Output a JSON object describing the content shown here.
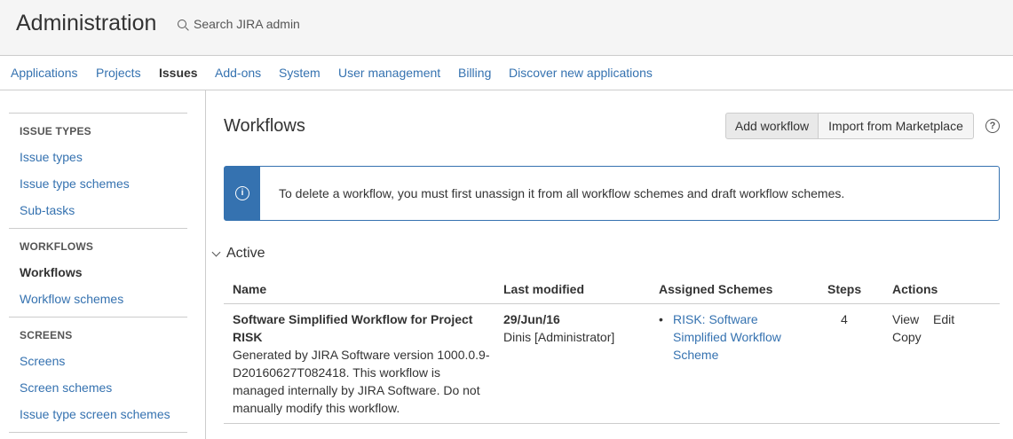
{
  "header": {
    "title": "Administration",
    "search_placeholder": "Search JIRA admin"
  },
  "nav": {
    "tabs": [
      {
        "label": "Applications"
      },
      {
        "label": "Projects"
      },
      {
        "label": "Issues",
        "active": true
      },
      {
        "label": "Add-ons"
      },
      {
        "label": "System"
      },
      {
        "label": "User management"
      },
      {
        "label": "Billing"
      },
      {
        "label": "Discover new applications"
      }
    ]
  },
  "sidebar": {
    "sections": [
      {
        "heading": "ISSUE TYPES",
        "items": [
          "Issue types",
          "Issue type schemes",
          "Sub-tasks"
        ]
      },
      {
        "heading": "WORKFLOWS",
        "items": [
          "Workflows",
          "Workflow schemes"
        ],
        "active_item": "Workflows"
      },
      {
        "heading": "SCREENS",
        "items": [
          "Screens",
          "Screen schemes",
          "Issue type screen schemes"
        ]
      }
    ]
  },
  "main": {
    "title": "Workflows",
    "buttons": {
      "add": "Add workflow",
      "import": "Import from Marketplace"
    },
    "help_icon": "?",
    "info": {
      "icon": "i",
      "text": "To delete a workflow, you must first unassign it from all workflow schemes and draft workflow schemes."
    },
    "section_label": "Active",
    "table": {
      "headers": [
        "Name",
        "Last modified",
        "Assigned Schemes",
        "Steps",
        "Actions"
      ],
      "rows": [
        {
          "name": "Software Simplified Workflow for Project RISK",
          "description": "Generated by JIRA Software version 1000.0.9-D20160627T082418. This workflow is managed internally by JIRA Software. Do not manually modify this workflow.",
          "last_modified_date": "29/Jun/16",
          "last_modified_by": "Dinis [Administrator]",
          "scheme_bullet": "•",
          "scheme": "RISK: Software Simplified Workflow Scheme",
          "steps": "4",
          "actions": [
            "View",
            "Edit",
            "Copy"
          ]
        }
      ]
    }
  }
}
